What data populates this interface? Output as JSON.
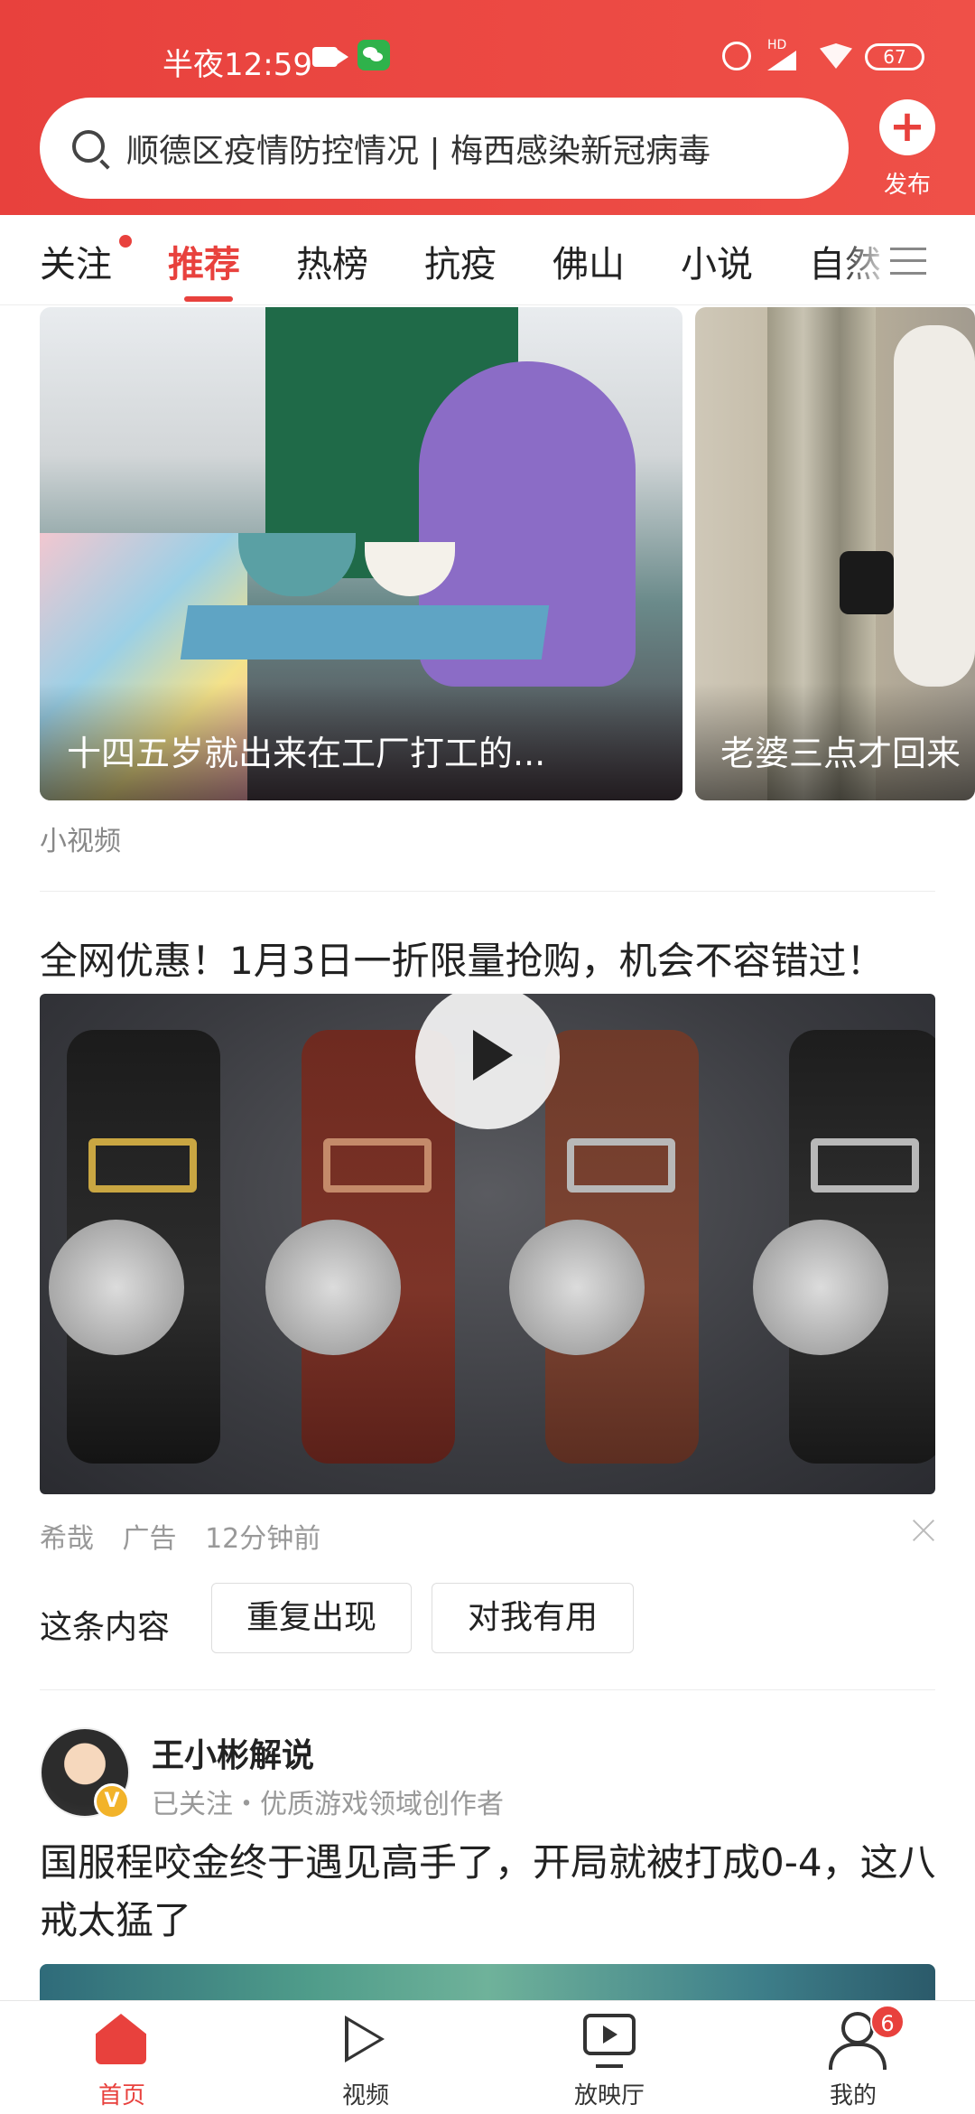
{
  "status_bar": {
    "time": "半夜12:59",
    "hd": "HD",
    "battery": "67",
    "icons": [
      "video-record-icon",
      "wechat-icon",
      "alarm-icon",
      "signal-icon",
      "wifi-icon",
      "battery-icon"
    ]
  },
  "search": {
    "text": "顺德区疫情防控情况 | 梅西感染新冠病毒",
    "icon": "search-icon"
  },
  "publish": {
    "label": "发布",
    "icon": "plus-icon"
  },
  "tabs": [
    {
      "label": "关注",
      "has_dot": true
    },
    {
      "label": "推荐",
      "active": true
    },
    {
      "label": "热榜"
    },
    {
      "label": "抗疫"
    },
    {
      "label": "佛山"
    },
    {
      "label": "小说"
    },
    {
      "label": "自然"
    }
  ],
  "small_videos": {
    "cards": [
      {
        "caption": "十四五岁就出来在工厂打工的..."
      },
      {
        "caption": "老婆三点才回来"
      }
    ],
    "section_label": "小视频"
  },
  "ad": {
    "title": "全网优惠！1月3日一折限量抢购，机会不容错过！",
    "source": "希哉",
    "tag": "广告",
    "time": "12分钟前"
  },
  "feedback": {
    "label": "这条内容",
    "buttons": [
      "重复出现",
      "对我有用"
    ]
  },
  "post": {
    "author": "王小彬解说",
    "author_desc": "已关注・优质游戏领域创作者",
    "verified_mark": "V",
    "title": "国服程咬金终于遇见高手了，开局就被打成0-4，这八戒太猛了"
  },
  "bottom_nav": {
    "items": [
      {
        "label": "首页",
        "icon": "home-icon",
        "active": true
      },
      {
        "label": "视频",
        "icon": "play-outline-icon"
      },
      {
        "label": "放映厅",
        "icon": "theater-icon"
      },
      {
        "label": "我的",
        "icon": "user-icon",
        "badge": "6"
      }
    ]
  },
  "colors": {
    "brand": "#e8413d",
    "text": "#222222",
    "muted": "#999999"
  }
}
